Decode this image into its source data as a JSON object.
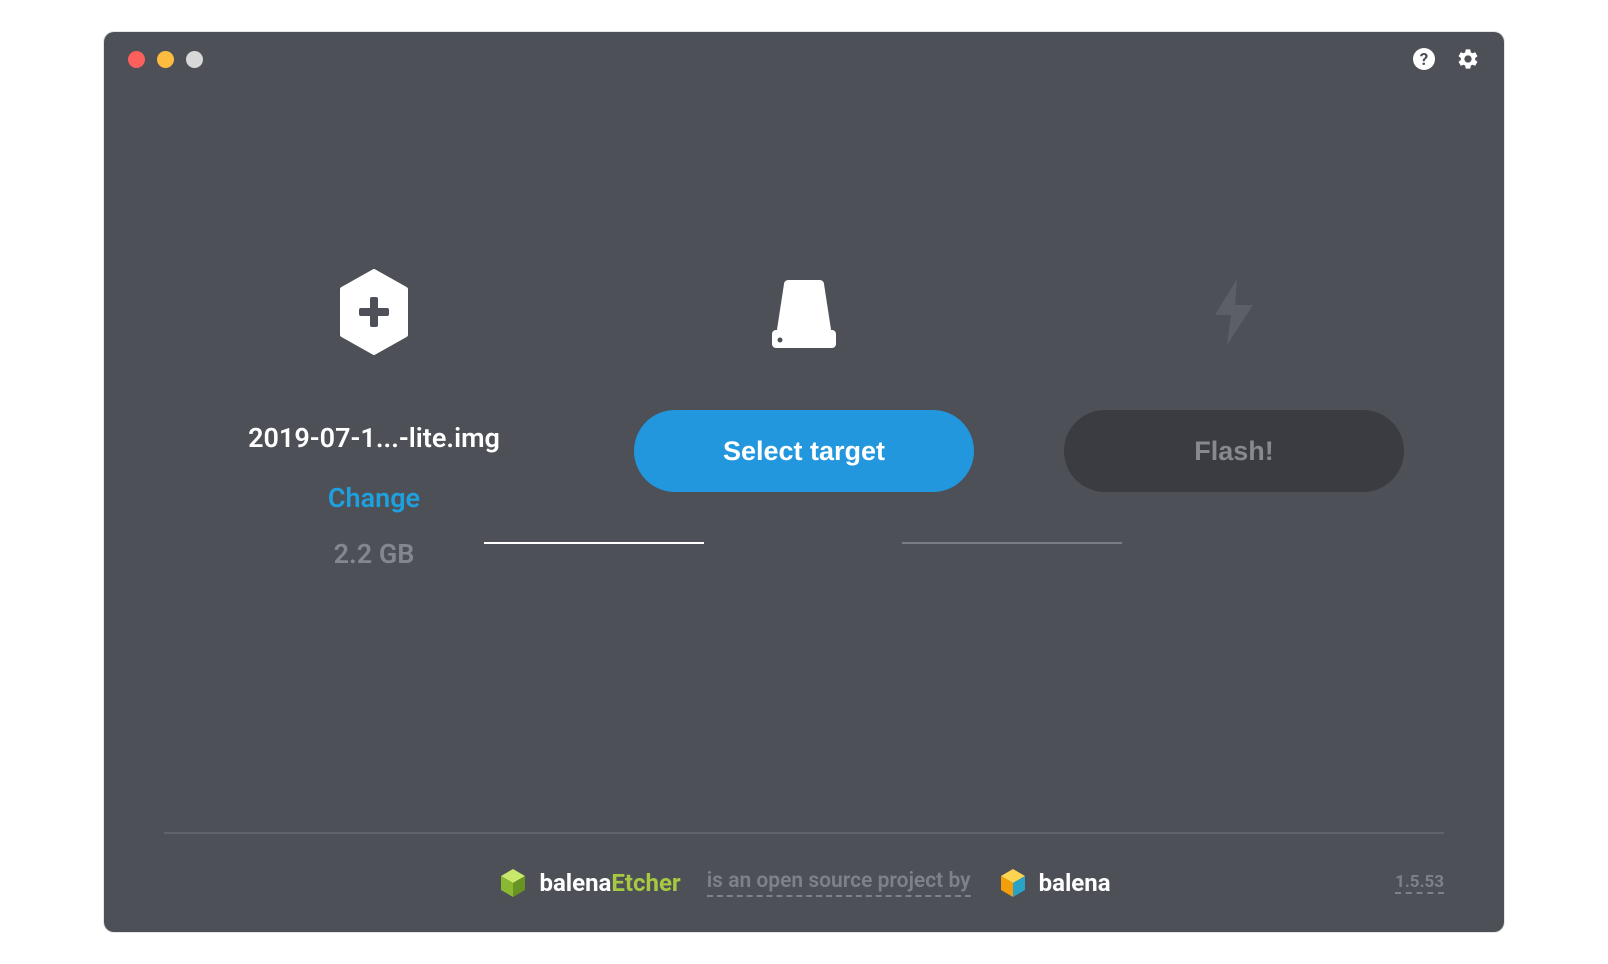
{
  "step1": {
    "filename": "2019-07-1...-lite.img",
    "change": "Change",
    "size": "2.2 GB"
  },
  "step2": {
    "button": "Select target"
  },
  "step3": {
    "button": "Flash!"
  },
  "footer": {
    "brand_prefix": "balena",
    "brand_suffix": "Etcher",
    "tagline": "is an open source project by",
    "company": "balena",
    "version": "1.5.53"
  }
}
